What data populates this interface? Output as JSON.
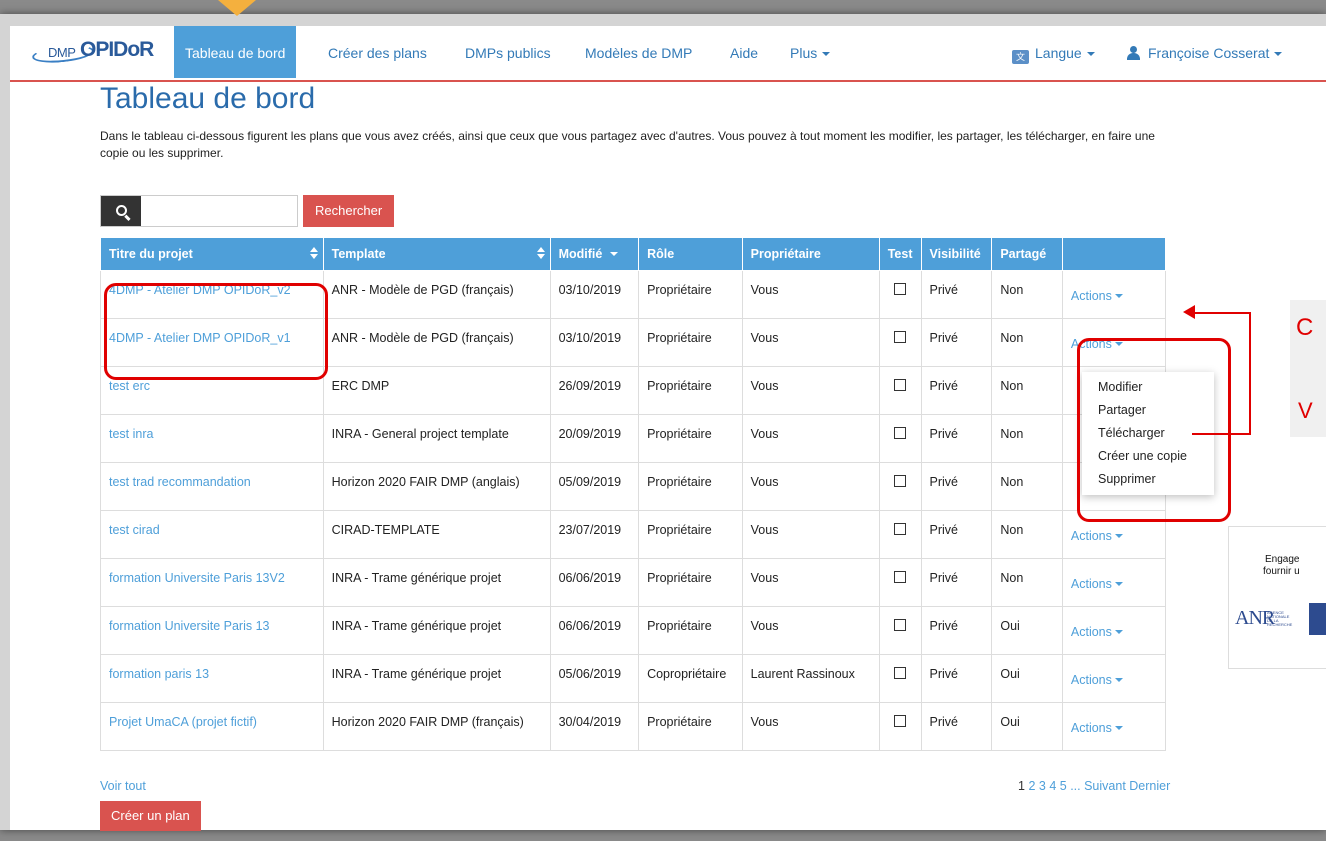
{
  "nav": {
    "logo_prefix": "DMP",
    "logo_main": "OPIDoR",
    "items": [
      "Tableau de bord",
      "Créer des plans",
      "DMPs publics",
      "Modèles de DMP",
      "Aide",
      "Plus"
    ],
    "language": "Langue",
    "user": "Françoise Cosserat"
  },
  "page": {
    "title": "Tableau de bord",
    "intro": "Dans le tableau ci-dessous figurent les plans que vous avez créés, ainsi que ceux que vous partagez avec d'autres. Vous pouvez à tout moment les modifier, les partager, les télécharger, en faire une copie ou les supprimer."
  },
  "search": {
    "placeholder": "",
    "button": "Rechercher"
  },
  "table": {
    "headers": [
      "Titre du projet",
      "Template",
      "Modifié",
      "Rôle",
      "Propriétaire",
      "Test",
      "Visibilité",
      "Partagé",
      ""
    ],
    "actions_label": "Actions",
    "rows": [
      [
        "4DMP - Atelier DMP OPIDoR_v2",
        "ANR - Modèle de PGD (français)",
        "03/10/2019",
        "Propriétaire",
        "Vous",
        "Privé",
        "Non"
      ],
      [
        "4DMP - Atelier DMP OPIDoR_v1",
        "ANR - Modèle de PGD (français)",
        "03/10/2019",
        "Propriétaire",
        "Vous",
        "Privé",
        "Non"
      ],
      [
        "test erc",
        "ERC DMP",
        "26/09/2019",
        "Propriétaire",
        "Vous",
        "Privé",
        "Non"
      ],
      [
        "test inra",
        "INRA - General project template",
        "20/09/2019",
        "Propriétaire",
        "Vous",
        "Privé",
        "Non"
      ],
      [
        "test trad recommandation",
        "Horizon 2020 FAIR DMP (anglais)",
        "05/09/2019",
        "Propriétaire",
        "Vous",
        "Privé",
        "Non"
      ],
      [
        "test cirad",
        "CIRAD-TEMPLATE",
        "23/07/2019",
        "Propriétaire",
        "Vous",
        "Privé",
        "Non"
      ],
      [
        "formation Universite Paris 13V2",
        "INRA - Trame générique projet",
        "06/06/2019",
        "Propriétaire",
        "Vous",
        "Privé",
        "Non"
      ],
      [
        "formation Universite Paris 13",
        "INRA - Trame générique projet",
        "06/06/2019",
        "Propriétaire",
        "Vous",
        "Privé",
        "Oui"
      ],
      [
        "formation paris 13",
        "INRA - Trame générique projet",
        "05/06/2019",
        "Copropriétaire",
        "Laurent Rassinoux",
        "Privé",
        "Oui"
      ],
      [
        "Projet UmaCA (projet fictif)",
        "Horizon 2020 FAIR DMP (français)",
        "30/04/2019",
        "Propriétaire",
        "Vous",
        "Privé",
        "Oui"
      ]
    ]
  },
  "dropdown": [
    "Modifier",
    "Partager",
    "Télécharger",
    "Créer une copie",
    "Supprimer"
  ],
  "side": {
    "panel_glyph_top": "C",
    "panel_glyph_bottom": "V",
    "promo_line1": "Engage",
    "promo_line2": "fournir u",
    "promo_logo": "ANR",
    "promo_logo_sub": "AGENCE NATIONALE DE LA RECHERCHE"
  },
  "footer": {
    "voir_tout": "Voir tout",
    "pages": [
      "1",
      "2",
      "3",
      "4",
      "5"
    ],
    "ellipsis": "...",
    "next": "Suivant",
    "last": "Dernier",
    "create": "Créer un plan"
  },
  "colors": {
    "primary": "#4e9fd9",
    "danger": "#d9534f",
    "annotation": "#e00000",
    "pointer": "#f4b03e"
  }
}
